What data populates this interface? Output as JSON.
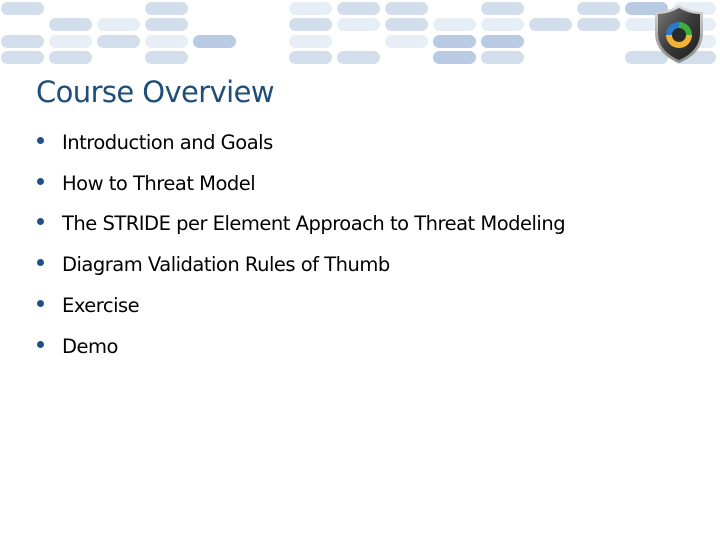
{
  "slide": {
    "title": "Course Overview",
    "bullets": [
      "Introduction and Goals",
      "How to Threat Model",
      "The STRIDE per Element Approach to Threat Modeling",
      "Diagram Validation Rules of Thumb",
      "Exercise",
      "Demo"
    ]
  },
  "colors": {
    "title": "#1f4e79",
    "bullet": "#1f5089",
    "body_text": "#000000",
    "banner_pill_light": "#e8eef6",
    "banner_pill_mid": "#d3deec",
    "banner_pill_dark": "#b9cbe3"
  },
  "icons": {
    "logo": "shield-logo-icon"
  }
}
